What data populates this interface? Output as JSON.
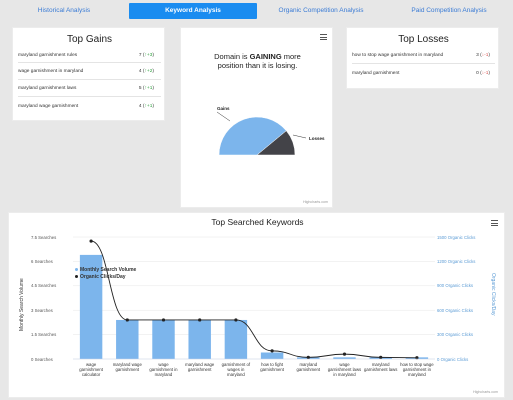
{
  "tabs": [
    {
      "label": "Historical Analysis",
      "active": false
    },
    {
      "label": "Keyword Analysis",
      "active": true
    },
    {
      "label": "Organic Competition Analysis",
      "active": false
    },
    {
      "label": "Paid Competition Analysis",
      "active": false
    }
  ],
  "top_gains": {
    "title": "Top Gains",
    "rows": [
      {
        "keyword": "maryland garnishment rules",
        "value": "7",
        "change": "+3"
      },
      {
        "keyword": "wage garnishment in maryland",
        "value": "4",
        "change": "+2"
      },
      {
        "keyword": "maryland garnishment laws",
        "value": "5",
        "change": "+1"
      },
      {
        "keyword": "maryland wage garnishment",
        "value": "4",
        "change": "+1"
      }
    ]
  },
  "top_losses": {
    "title": "Top Losses",
    "rows": [
      {
        "keyword": "how to stop wage garnishment in maryland",
        "value": "3",
        "change": "-1"
      },
      {
        "keyword": "maryland garnishment",
        "value": "0",
        "change": "-1"
      }
    ]
  },
  "gauge": {
    "line1_a": "Domain is ",
    "line1_b": "GAINING",
    "line1_c": " more",
    "line2": "position than it is losing.",
    "gains_label": "Gains",
    "losses_label": "Losses",
    "gains_color": "#7cb5ec",
    "losses_color": "#434348",
    "credits": "Highcharts.com"
  },
  "chart_data": {
    "type": "bar",
    "title": "Top Searched Keywords",
    "categories": [
      "wage garnishment calculator",
      "maryland wage garnishment",
      "wage garnishment in maryland",
      "maryland wage garnishment",
      "garnishment of wages in maryland",
      "how to fight garnishment",
      "maryland garnishment",
      "wage garnishment laws in maryland",
      "maryland garnishment laws",
      "how to stop wage garnishment in maryland"
    ],
    "series": [
      {
        "name": "Monthly Search Volume",
        "type": "bar",
        "color": "#7cb5ec",
        "values": [
          6.4,
          2.4,
          2.4,
          2.4,
          2.4,
          0.4,
          0.1,
          0.1,
          0.1,
          0.1
        ]
      },
      {
        "name": "Organic Clicks/Day",
        "type": "line",
        "color": "#222222",
        "values": [
          1450,
          480,
          480,
          480,
          480,
          100,
          20,
          60,
          20,
          15
        ]
      }
    ],
    "ylabel": "Monthly Search Volume",
    "ylabel_right": "Organic Clicks/Day",
    "yticks": [
      "7.5 Searches",
      "6 Searches",
      "4.5 Searches",
      "3 Searches",
      "1.5 Searches",
      "0 Searches"
    ],
    "yticks_right": [
      "1500 Organic Clicks",
      "1200 Organic Clicks",
      "900 Organic Clicks",
      "600 Organic Clicks",
      "300 Organic Clicks",
      "0 Organic Clicks"
    ],
    "ylim": [
      0,
      7.5
    ],
    "ylim_right": [
      0,
      1500
    ],
    "credits": "Highcharts.com"
  }
}
